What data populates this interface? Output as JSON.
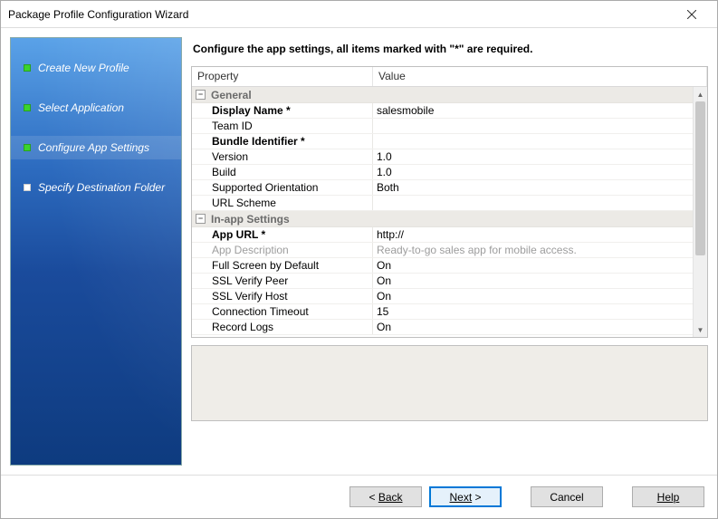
{
  "window": {
    "title": "Package Profile Configuration Wizard"
  },
  "sidebar": {
    "steps": [
      {
        "label": "Create New Profile",
        "state": "done"
      },
      {
        "label": "Select Application",
        "state": "done"
      },
      {
        "label": "Configure App Settings",
        "state": "done",
        "current": true
      },
      {
        "label": "Specify Destination Folder",
        "state": "pending"
      }
    ]
  },
  "main": {
    "instruction": "Configure the app settings, all items marked with \"*\" are required.",
    "columns": {
      "property": "Property",
      "value": "Value"
    },
    "groups": [
      {
        "name": "General",
        "rows": [
          {
            "label": "Display Name *",
            "value": "salesmobile",
            "bold": true
          },
          {
            "label": "Team ID",
            "value": ""
          },
          {
            "label": "Bundle Identifier *",
            "value": "",
            "bold": true
          },
          {
            "label": "Version",
            "value": "1.0"
          },
          {
            "label": "Build",
            "value": "1.0"
          },
          {
            "label": "Supported Orientation",
            "value": "Both"
          },
          {
            "label": "URL Scheme",
            "value": ""
          }
        ]
      },
      {
        "name": "In-app Settings",
        "rows": [
          {
            "label": "App URL *",
            "value": "http://",
            "bold": true
          },
          {
            "label": "App Description",
            "value": "Ready-to-go sales app for mobile access.",
            "disabled": true
          },
          {
            "label": "Full Screen by Default",
            "value": "On"
          },
          {
            "label": "SSL Verify Peer",
            "value": "On"
          },
          {
            "label": "SSL Verify Host",
            "value": "On"
          },
          {
            "label": "Connection Timeout",
            "value": "15"
          },
          {
            "label": "Record Logs",
            "value": "On"
          }
        ]
      }
    ]
  },
  "buttons": {
    "back": "Back",
    "next": "Next",
    "cancel": "Cancel",
    "help": "Help"
  }
}
